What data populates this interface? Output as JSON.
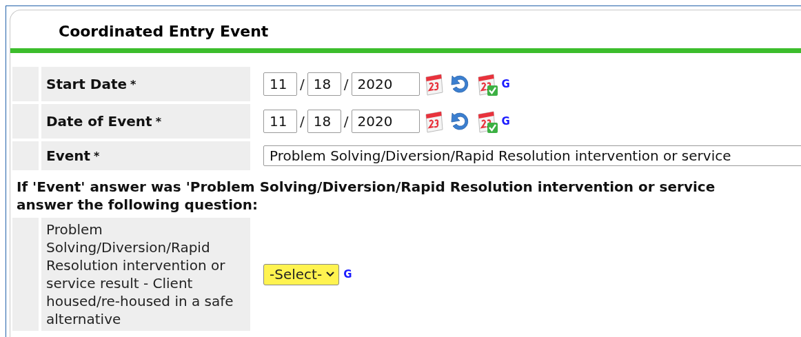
{
  "panel": {
    "title": "Coordinated Entry Event"
  },
  "rows": [
    {
      "kind": "date",
      "label": "Start Date",
      "required_mark": "*",
      "month": "11",
      "day": "18",
      "year": "2020",
      "separator": "/",
      "help": "G"
    },
    {
      "kind": "date",
      "label": "Date of Event",
      "required_mark": "*",
      "month": "11",
      "day": "18",
      "year": "2020",
      "separator": "/",
      "help": "G"
    },
    {
      "kind": "text",
      "label": "Event",
      "required_mark": "*",
      "value": "Problem Solving/Diversion/Rapid Resolution intervention or service"
    }
  ],
  "question": "If 'Event' answer was 'Problem Solving/Diversion/Rapid Resolution intervention or service\nanswer the following question:",
  "followup": {
    "kind": "select",
    "label": "Problem Solving/Diversion/Rapid Resolution intervention or service result - Client housed/re-housed in a safe alternative",
    "value": "-Select-",
    "help": "G"
  }
}
